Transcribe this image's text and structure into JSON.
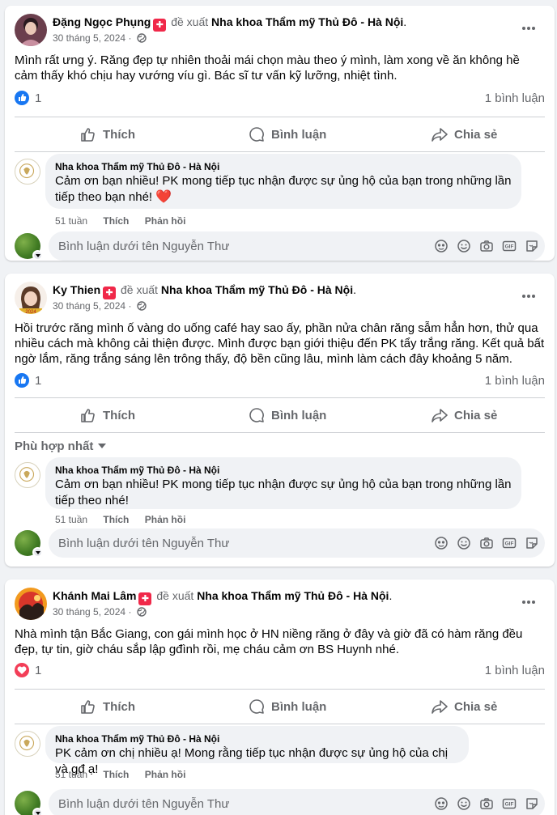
{
  "posts": [
    {
      "author": "Đặng Ngọc Phụng",
      "recommend_text": "đề xuất",
      "page": "Nha khoa Thẩm mỹ Thủ Đô - Hà Nội",
      "date": "30 tháng 5, 2024",
      "dot": "·",
      "body": "Mình rất ưng ý. Răng đẹp tự nhiên thoải mái chọn màu theo ý mình, làm xong về ăn không hề cảm thấy khó chịu hay vướng víu gì. Bác sĩ tư vấn kỹ lưỡng, nhiệt tình.",
      "reaction_type": "like",
      "reaction_count": "1",
      "comment_count": "1 bình luận",
      "reply": {
        "author": "Nha khoa Thẩm mỹ Thủ Đô - Hà Nội",
        "text": "Cảm ơn bạn nhiều! PK mong tiếp tục nhận được sự ủng hộ của bạn trong những lần tiếp theo bạn nhé!",
        "emoji": "❤️",
        "time": "51 tuần",
        "like": "Thích",
        "reply": "Phản hồi"
      }
    },
    {
      "author": "Ky Thien",
      "recommend_text": "đề xuất",
      "page": "Nha khoa Thẩm mỹ Thủ Đô - Hà Nội",
      "date": "30 tháng 5, 2024",
      "dot": "·",
      "body": "Hồi trước răng mình ố vàng do uống café hay sao ấy, phần nửa chân răng sẫm hẳn hơn, thử qua nhiều cách mà không cải thiện được. Mình được bạn giới thiệu đến PK tẩy trắng răng. Kết quả bất ngờ lắm, răng trắng sáng lên trông thấy, độ bền cũng lâu, mình làm cách đây khoảng 5 năm.",
      "reaction_type": "like",
      "reaction_count": "1",
      "comment_count": "1 bình luận",
      "sort_label": "Phù hợp nhất",
      "reply": {
        "author": "Nha khoa Thẩm mỹ Thủ Đô - Hà Nội",
        "text": "Cảm ơn bạn nhiều! PK mong tiếp tục nhận được sự ủng hộ của bạn trong những lần tiếp theo nhé!",
        "time": "51 tuần",
        "like": "Thích",
        "reply": "Phản hồi"
      }
    },
    {
      "author": "Khánh Mai Lâm",
      "recommend_text": "đề xuất",
      "page": "Nha khoa Thẩm mỹ Thủ Đô - Hà Nội",
      "date": "30 tháng 5, 2024",
      "dot": "·",
      "body": "Nhà mình tận Bắc Giang, con gái mình học ở HN niềng răng ở đây và giờ đã có hàm răng đều đẹp, tự tin, giờ cháu sắp lập gđình rồi, mẹ cháu cảm ơn BS Huynh nhé.",
      "reaction_type": "love",
      "reaction_count": "1",
      "comment_count": "1 bình luận",
      "reply": {
        "author": "Nha khoa Thẩm mỹ Thủ Đô - Hà Nội",
        "text": "PK cảm ơn chị nhiều ạ! Mong rằng tiếp tục nhận được sự ủng hộ của chị và gđ ạ!",
        "time": "51 tuần",
        "like": "Thích",
        "reply": "Phản hồi"
      }
    }
  ],
  "actions": {
    "like": "Thích",
    "comment": "Bình luận",
    "share": "Chia sẻ"
  },
  "composer": {
    "placeholder": "Bình luận dưới tên Nguyễn Thư"
  },
  "icons": {
    "like": "like-icon",
    "comment": "comment-icon",
    "share": "share-icon",
    "globe": "globe-icon",
    "more": "more-dots-icon",
    "recommend": "recommend-badge-icon",
    "composer_tools": [
      "avatar-sticker-icon",
      "emoji-icon",
      "camera-icon",
      "gif-icon",
      "sticker-icon"
    ]
  },
  "colors": {
    "like_blue": "#1877f2",
    "love_red": "#f33e58",
    "badge_red": "#f02849",
    "muted": "#65676b"
  }
}
